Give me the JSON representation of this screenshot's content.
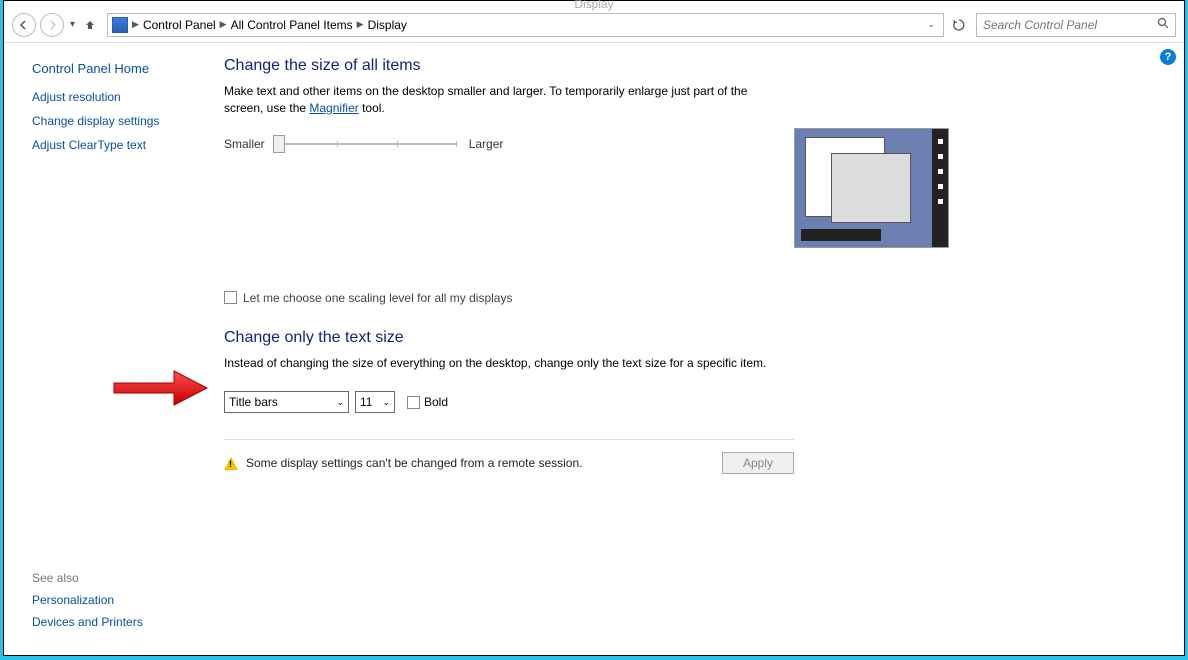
{
  "titlebar": "Display",
  "breadcrumbs": [
    "Control Panel",
    "All Control Panel Items",
    "Display"
  ],
  "search_placeholder": "Search Control Panel",
  "sidebar": {
    "home": "Control Panel Home",
    "links": [
      "Adjust resolution",
      "Change display settings",
      "Adjust ClearType text"
    ]
  },
  "see_also": {
    "label": "See also",
    "links": [
      "Personalization",
      "Devices and Printers"
    ]
  },
  "main": {
    "heading1": "Change the size of all items",
    "desc_before": "Make text and other items on the desktop smaller and larger. To temporarily enlarge just part of the screen, use the ",
    "magnifier_link": "Magnifier",
    "desc_after": " tool.",
    "smaller": "Smaller",
    "larger": "Larger",
    "checkbox_label": "Let me choose one scaling level for all my displays",
    "heading2": "Change only the text size",
    "desc2": "Instead of changing the size of everything on the desktop, change only the text size for a specific item.",
    "item_dropdown": "Title bars",
    "size_dropdown": "11",
    "bold_label": "Bold",
    "status": "Some display settings can't be changed from a remote session.",
    "apply": "Apply"
  }
}
